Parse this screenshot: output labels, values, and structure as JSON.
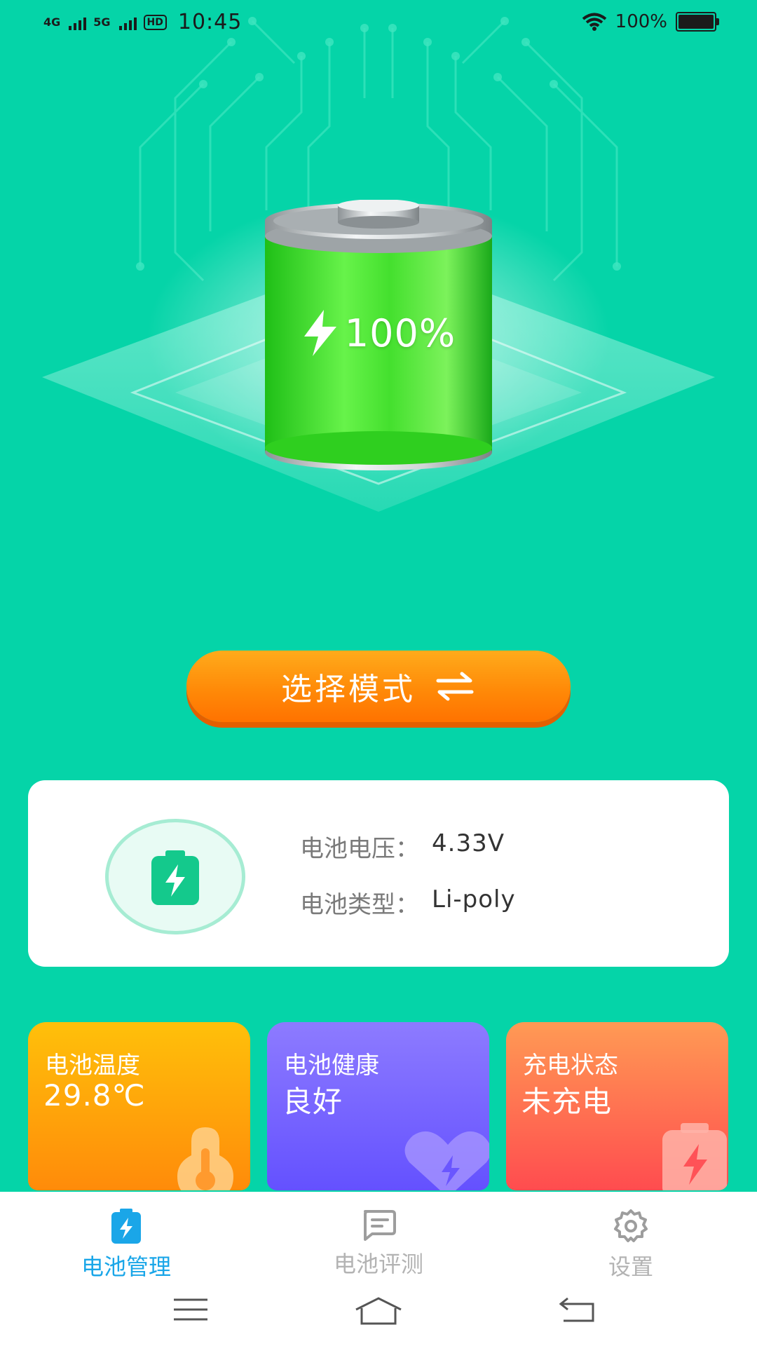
{
  "status_bar": {
    "network1": "4G",
    "network2": "5G",
    "hd": "HD",
    "time": "10:45",
    "battery_percent": "100%"
  },
  "hero": {
    "battery_level_label": "100%",
    "battery_level": 1.0
  },
  "mode_button": {
    "label": "选择模式"
  },
  "info_card": {
    "voltage_label": "电池电压：",
    "voltage_value": "4.33V",
    "type_label": "电池类型：",
    "type_value": "Li-poly"
  },
  "tiles": [
    {
      "title": "电池温度",
      "value": "29.8℃",
      "icon": "thermometer-icon"
    },
    {
      "title": "电池健康",
      "value": "良好",
      "icon": "heart-bolt-icon"
    },
    {
      "title": "充电状态",
      "value": "未充电",
      "icon": "battery-bolt-icon"
    }
  ],
  "bottom_nav": [
    {
      "label": "电池管理",
      "icon": "battery-manage-icon",
      "active": true
    },
    {
      "label": "电池评测",
      "icon": "evaluate-icon",
      "active": false
    },
    {
      "label": "设置",
      "icon": "gear-icon",
      "active": false
    }
  ],
  "colors": {
    "background": "#05d4a8",
    "accent_orange": "#ff8a08",
    "nav_active": "#1aa6e8",
    "nav_inactive": "#b3b3b3"
  }
}
